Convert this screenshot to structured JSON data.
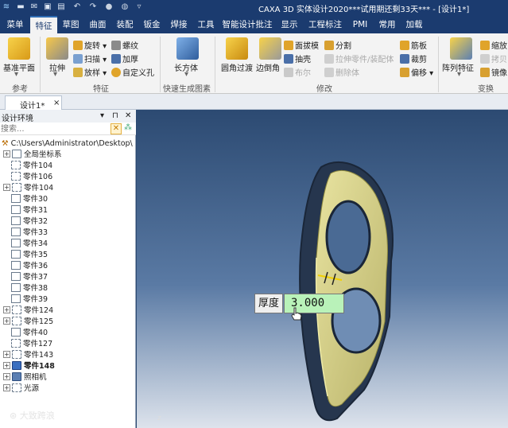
{
  "window": {
    "title": "CAXA 3D 实体设计2020***试用期还剩33天*** - [设计1*]",
    "quick_access_icons": [
      "app-logo-icon",
      "new-icon",
      "mail-icon",
      "save-icon",
      "print-icon",
      "undo-icon",
      "redo-icon",
      "record-icon",
      "dropdown-icon"
    ]
  },
  "menu": {
    "tabs": [
      "菜单",
      "特征",
      "草图",
      "曲面",
      "装配",
      "钣金",
      "焊接",
      "工具",
      "智能设计批注",
      "显示",
      "工程标注",
      "PMI",
      "常用",
      "加载"
    ],
    "active_index": 1
  },
  "ribbon": {
    "datum_plane": "基准平面",
    "extrude": "拉伸",
    "revolve": "旋转",
    "sweep": "扫描",
    "loft": "放样",
    "thread": "螺纹",
    "thicken": "加厚",
    "custom_hole": "自定义孔",
    "block": "长方体",
    "fillet": "圆角过渡",
    "chamfer": "边倒角",
    "face_draft": "面拔模",
    "shell": "抽壳",
    "boolean": "布尔",
    "split": "分割",
    "extrude_to_part": "拉伸零件/装配体",
    "delete_body": "删除体",
    "rib": "筋板",
    "trim": "裁剪",
    "offset": "偏移",
    "pattern": "阵列特征",
    "scale": "缩放",
    "copy": "拷贝",
    "mirror": "镜像",
    "groups": {
      "reference": "参考",
      "feature": "特征",
      "quick_shape": "快速生成图素",
      "modify": "修改",
      "transform": "变换"
    }
  },
  "document_tab": {
    "label": "设计1*",
    "close": "×"
  },
  "panel": {
    "title": "设计环境",
    "pin": "▾ ⊓ ✕",
    "search_placeholder": "搜索...",
    "search_clear": "✕",
    "search_option": "⁂",
    "root_path": "C:\\Users\\Administrator\\Desktop\\",
    "items": [
      {
        "label": "全局坐标系",
        "icon": "axis-icon",
        "expand": "+",
        "indent": 1
      },
      {
        "label": "零件104",
        "icon": "ghost-part-icon",
        "expand": "",
        "indent": 1
      },
      {
        "label": "零件106",
        "icon": "ghost-part-icon",
        "expand": "",
        "indent": 1
      },
      {
        "label": "零件104",
        "icon": "ghost-part-icon",
        "expand": "+",
        "indent": 0
      },
      {
        "label": "零件30",
        "icon": "part-icon",
        "expand": "",
        "indent": 1
      },
      {
        "label": "零件31",
        "icon": "part-icon",
        "expand": "",
        "indent": 1
      },
      {
        "label": "零件32",
        "icon": "part-icon",
        "expand": "",
        "indent": 1
      },
      {
        "label": "零件33",
        "icon": "part-icon",
        "expand": "",
        "indent": 1
      },
      {
        "label": "零件34",
        "icon": "part-icon",
        "expand": "",
        "indent": 1
      },
      {
        "label": "零件35",
        "icon": "part-icon",
        "expand": "",
        "indent": 1
      },
      {
        "label": "零件36",
        "icon": "part-icon",
        "expand": "",
        "indent": 1
      },
      {
        "label": "零件37",
        "icon": "part-icon",
        "expand": "",
        "indent": 1
      },
      {
        "label": "零件38",
        "icon": "part-icon",
        "expand": "",
        "indent": 1
      },
      {
        "label": "零件39",
        "icon": "part-icon",
        "expand": "",
        "indent": 1
      },
      {
        "label": "零件124",
        "icon": "ghost-part-icon",
        "expand": "+",
        "indent": 0
      },
      {
        "label": "零件125",
        "icon": "ghost-part-icon",
        "expand": "+",
        "indent": 0
      },
      {
        "label": "零件40",
        "icon": "part-icon",
        "expand": "",
        "indent": 1
      },
      {
        "label": "零件127",
        "icon": "ghost-part-icon",
        "expand": "",
        "indent": 1
      },
      {
        "label": "零件143",
        "icon": "ghost-part-icon",
        "expand": "+",
        "indent": 0
      },
      {
        "label": "零件148",
        "icon": "solid-part-icon",
        "expand": "+",
        "indent": 0,
        "bold": true
      },
      {
        "label": "照相机",
        "icon": "camera-icon",
        "expand": "+",
        "indent": 0
      },
      {
        "label": "光源",
        "icon": "light-icon",
        "expand": "+",
        "indent": 0
      }
    ]
  },
  "viewport": {
    "thickness_label": "厚度",
    "thickness_value": "3.000",
    "axis_label": "z",
    "watermark": "大致跨浪",
    "colors": {
      "background_top": "#2c4a72",
      "background_bottom": "#dde3ec",
      "part_body": "#2a3a52",
      "selected_face": "#d9d48a"
    }
  }
}
